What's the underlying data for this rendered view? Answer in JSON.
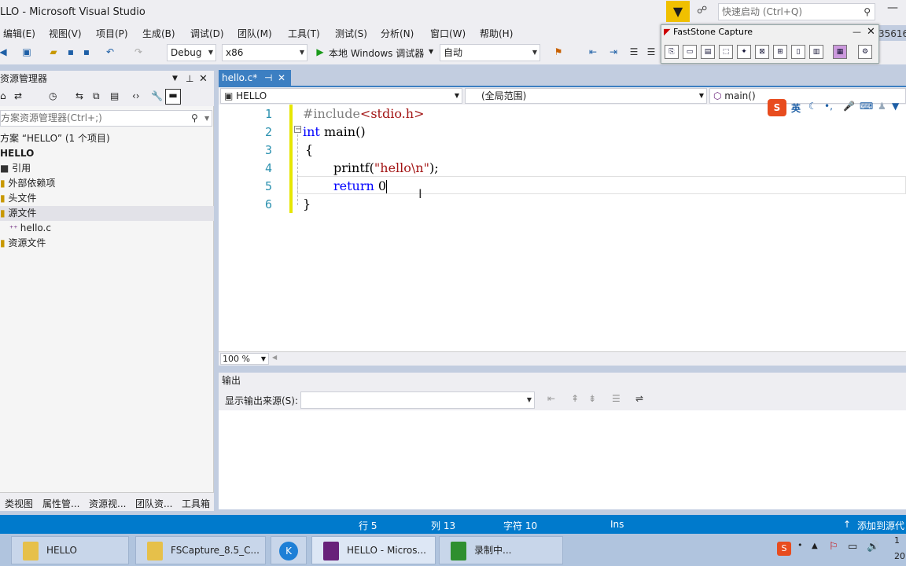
{
  "window": {
    "title": "LLO - Microsoft Visual Studio",
    "quick_launch_placeholder": "快速启动 (Ctrl+Q)",
    "overflow_text": "35616"
  },
  "menu": [
    "编辑(E)",
    "视图(V)",
    "项目(P)",
    "生成(B)",
    "调试(D)",
    "团队(M)",
    "工具(T)",
    "测试(S)",
    "分析(N)",
    "窗口(W)",
    "帮助(H)"
  ],
  "toolbar": {
    "config": "Debug",
    "platform": "x86",
    "debugger_label": "本地 Windows 调试器",
    "debugger_mode": "自动"
  },
  "fastcapture": {
    "title": "FastStone Capture"
  },
  "solution_explorer": {
    "title": "资源管理器",
    "search_placeholder": "方案资源管理器(Ctrl+;)",
    "tree": [
      "方案 “HELLO” (1 个项目)",
      "HELLO",
      "引用",
      "外部依赖项",
      "头文件",
      "源文件",
      "hello.c",
      "资源文件"
    ],
    "tabs": [
      "类视图",
      "属性管...",
      "资源视...",
      "团队资...",
      "工具箱"
    ]
  },
  "editor": {
    "tab": "hello.c*",
    "nav_project": "HELLO",
    "nav_scope": "(全局范围)",
    "nav_member": "main()",
    "lines": [
      "1",
      "2",
      "3",
      "4",
      "5",
      "6"
    ],
    "code": {
      "l1_pp": "#include",
      "l1_rest": "<stdio.h>",
      "l2_kw": "int",
      "l2_rest": " main()",
      "l3": "{",
      "l4_a": "printf(",
      "l4_str": "\"hello\\n\"",
      "l4_b": ");",
      "l5_kw": "return",
      "l5_rest": " 0",
      "l6": "}"
    },
    "zoom": "100 %",
    "ime": "英"
  },
  "output": {
    "title": "输出",
    "source_label": "显示输出来源(S):"
  },
  "status": {
    "line": "行 5",
    "col": "列 13",
    "char": "字符 10",
    "mode": "Ins",
    "source_control": "添加到源代"
  },
  "taskbar": {
    "items": [
      "HELLO",
      "FSCapture_8.5_C...",
      "",
      "HELLO - Micros...",
      "录制中..."
    ],
    "clock_top": "1",
    "clock_bottom": "20"
  },
  "colors": {
    "accent": "#007acc",
    "tab": "#3c7fc2",
    "keyword": "#0000ff",
    "string": "#a31515"
  }
}
